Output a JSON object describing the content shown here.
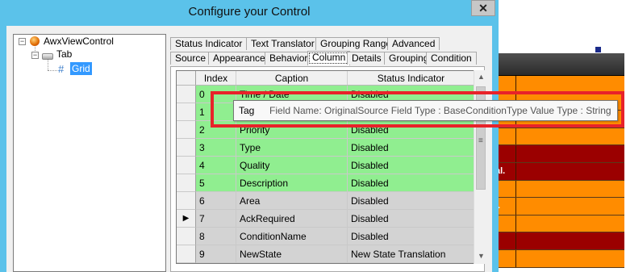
{
  "window": {
    "title": "Configure your Control",
    "close_glyph": "✕"
  },
  "tree": {
    "root": {
      "label": "AwxViewControl",
      "icon": "control-icon"
    },
    "child": {
      "label": "Tab",
      "icon": "tab-icon"
    },
    "leaf": {
      "label": "Grid",
      "icon": "grid-icon"
    }
  },
  "tabs_row1": [
    "Status Indicator",
    "Text Translator",
    "Grouping Range",
    "Advanced"
  ],
  "tabs_row2": [
    "Source",
    "Appearance",
    "Behavior",
    "Column",
    "Details",
    "Grouping",
    "Condition"
  ],
  "active_tab": "Column",
  "grid": {
    "columns": [
      "Index",
      "Caption",
      "Status Indicator"
    ],
    "rows": [
      {
        "index": "0",
        "caption": "Time / Date",
        "status": "Disabled",
        "color": "green",
        "marker": ""
      },
      {
        "index": "1",
        "caption": "Tag",
        "status": "Disabled",
        "color": "green",
        "marker": ""
      },
      {
        "index": "2",
        "caption": "Priority",
        "status": "Disabled",
        "color": "green",
        "marker": ""
      },
      {
        "index": "3",
        "caption": "Type",
        "status": "Disabled",
        "color": "green",
        "marker": ""
      },
      {
        "index": "4",
        "caption": "Quality",
        "status": "Disabled",
        "color": "green",
        "marker": ""
      },
      {
        "index": "5",
        "caption": "Description",
        "status": "Disabled",
        "color": "green",
        "marker": ""
      },
      {
        "index": "6",
        "caption": "Area",
        "status": "Disabled",
        "color": "grey",
        "marker": ""
      },
      {
        "index": "7",
        "caption": "AckRequired",
        "status": "Disabled",
        "color": "grey",
        "marker": "▶"
      },
      {
        "index": "8",
        "caption": "ConditionName",
        "status": "Disabled",
        "color": "grey",
        "marker": ""
      },
      {
        "index": "9",
        "caption": "NewState",
        "status": "New State Translation",
        "color": "grey",
        "marker": ""
      }
    ]
  },
  "tooltip": {
    "cell_text": "Tag",
    "text": "Field Name: OriginalSource  Field Type : BaseConditionType  Value Type : String"
  },
  "scrollbar": {
    "up": "▲",
    "down": "▼",
    "grip": "≡"
  },
  "background_app": {
    "cells": [
      "",
      "",
      "",
      "",
      ".",
      "al.",
      ".",
      "..",
      "",
      "",
      ""
    ],
    "colors": {
      "orange": "#ff8c00",
      "darkred": "#9b0000",
      "header": "#3a3a3a"
    }
  },
  "colors": {
    "titlebar": "#5bc2ea",
    "row_green": "#90ee90",
    "row_grey": "#d3d3d3",
    "highlight": "#e8222a",
    "selection": "#3399ff"
  }
}
